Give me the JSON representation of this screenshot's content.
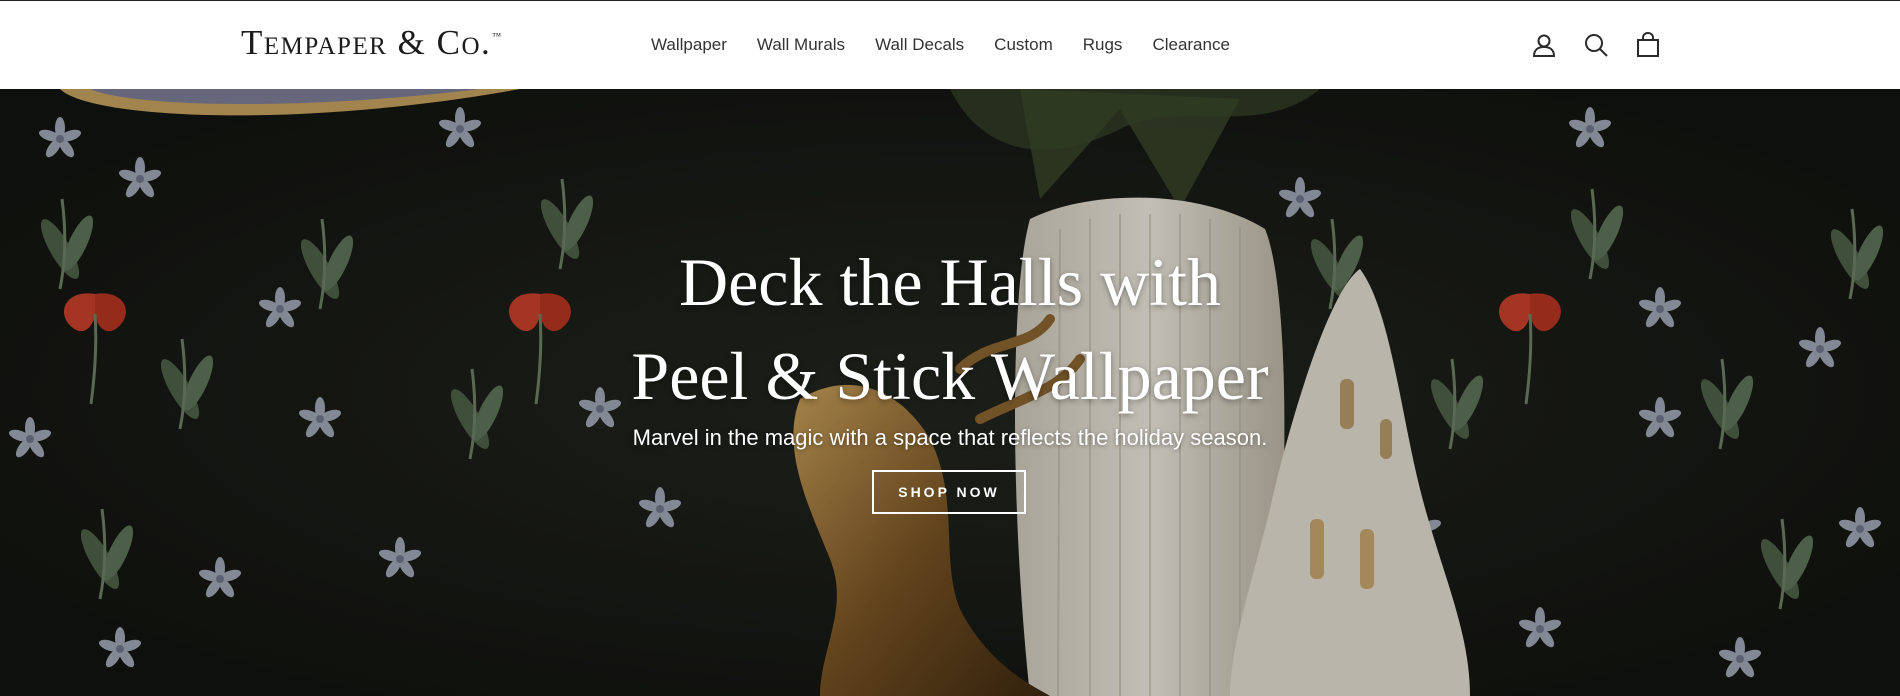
{
  "brand": {
    "name": "Tempaper & Co.",
    "trademark": "™"
  },
  "nav": {
    "items": [
      {
        "label": "Wallpaper"
      },
      {
        "label": "Wall Murals"
      },
      {
        "label": "Wall Decals"
      },
      {
        "label": "Custom"
      },
      {
        "label": "Rugs"
      },
      {
        "label": "Clearance"
      }
    ]
  },
  "header_icons": [
    {
      "name": "account-icon"
    },
    {
      "name": "search-icon"
    },
    {
      "name": "cart-icon"
    }
  ],
  "hero": {
    "title_line1": "Deck the Halls with",
    "title_line2": "Peel & Stick Wallpaper",
    "subtitle": "Marvel in the magic with a space that reflects the holiday season.",
    "cta_label": "SHOP NOW"
  },
  "colors": {
    "header_bg": "#ffffff",
    "text_dark": "#1c1c1c",
    "hero_bg": "#1a1c17",
    "hero_text": "#ffffff",
    "poppy_red": "#c8412b",
    "leaf_green": "#5f7458"
  }
}
